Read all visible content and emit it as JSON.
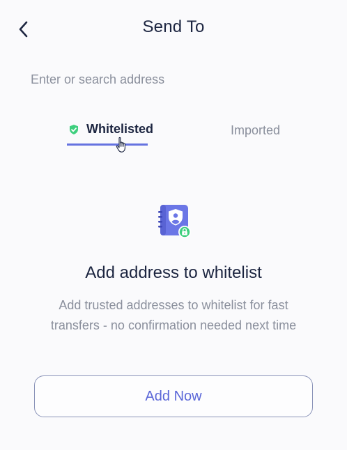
{
  "header": {
    "title": "Send To",
    "back_icon": "chevron-left-icon"
  },
  "search": {
    "placeholder": "Enter or search address",
    "value": ""
  },
  "tabs": [
    {
      "label": "Whitelisted",
      "icon": "shield-check-icon",
      "active": true
    },
    {
      "label": "Imported",
      "active": false
    }
  ],
  "empty_state": {
    "icon": "address-book-shield-icon",
    "title": "Add address to whitelist",
    "description": "Add trusted addresses to whitelist for fast transfers - no confirmation needed next time"
  },
  "actions": {
    "add_now_label": "Add Now"
  },
  "colors": {
    "accent": "#5b67d8",
    "tab_underline": "#6573e0",
    "success": "#3ecf7e",
    "text_primary": "#1c2540",
    "text_muted": "#8a8f9c"
  }
}
